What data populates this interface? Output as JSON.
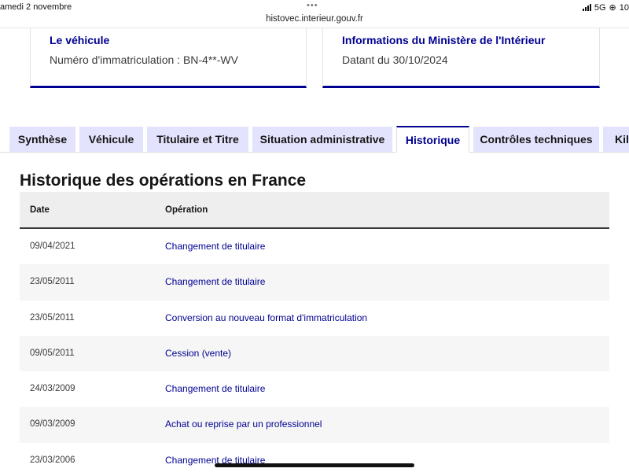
{
  "statusbar": {
    "datetime": "amedi 2 novembre",
    "dots": "•••",
    "url": "histovec.interieur.gouv.fr",
    "network": "5G",
    "battery": "10"
  },
  "cards": [
    {
      "title": "Le véhicule",
      "text": "Numéro d'immatriculation : BN-4**-WV"
    },
    {
      "title": "Informations du Ministère de l'Intérieur",
      "text": "Datant du 30/10/2024"
    }
  ],
  "tabs": [
    {
      "label": "Synthèse",
      "active": false
    },
    {
      "label": "Véhicule",
      "active": false
    },
    {
      "label": "Titulaire et Titre",
      "active": false
    },
    {
      "label": "Situation administrative",
      "active": false
    },
    {
      "label": "Historique",
      "active": true
    },
    {
      "label": "Contrôles techniques",
      "active": false
    },
    {
      "label": "Kilo",
      "active": false
    }
  ],
  "history": {
    "title": "Historique des opérations en France",
    "columns": {
      "date": "Date",
      "operation": "Opération"
    },
    "rows": [
      {
        "date": "09/04/2021",
        "operation": "Changement de titulaire"
      },
      {
        "date": "23/05/2011",
        "operation": "Changement de titulaire"
      },
      {
        "date": "23/05/2011",
        "operation": "Conversion au nouveau format d'immatriculation"
      },
      {
        "date": "09/05/2011",
        "operation": "Cession (vente)"
      },
      {
        "date": "24/03/2009",
        "operation": "Changement de titulaire"
      },
      {
        "date": "09/03/2009",
        "operation": "Achat ou reprise par un professionnel"
      },
      {
        "date": "23/03/2006",
        "operation": "Changement de titulaire"
      }
    ]
  },
  "colors": {
    "brand_blue": "#000091",
    "tab_bg": "#e3e3fd",
    "row_alt": "#f6f6f6"
  }
}
